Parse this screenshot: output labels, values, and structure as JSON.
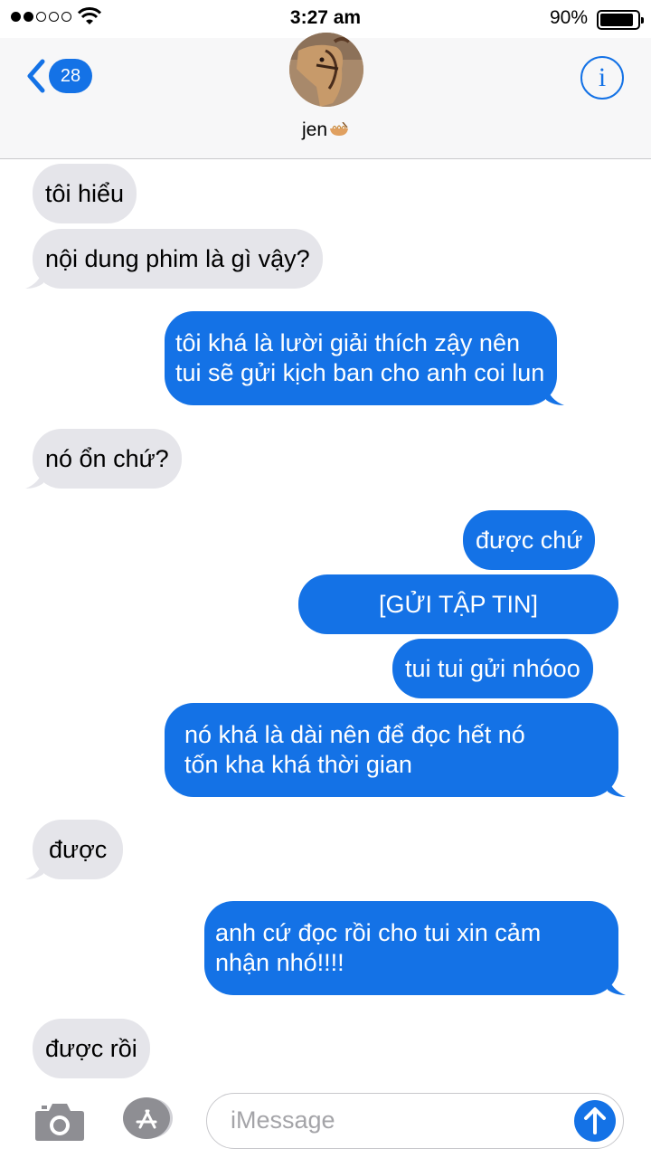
{
  "status_bar": {
    "time": "3:27 am",
    "battery": "90%",
    "battery_level": 0.9,
    "signal_bars": 2
  },
  "header": {
    "back_count": "28",
    "contact_name": "jen",
    "info_icon": "i"
  },
  "messages": [
    {
      "type": "received",
      "text": "tôi hiểu"
    },
    {
      "type": "received",
      "text": "nội dung phim là gì vậy?"
    },
    {
      "type": "sent",
      "lines": [
        "tôi khá là lười giải thích zậy nên",
        "tui sẽ gửi kịch ban cho anh coi lun"
      ]
    },
    {
      "type": "received",
      "text": "nó ổn chứ?"
    },
    {
      "type": "sent",
      "text": "được chứ"
    },
    {
      "type": "sent",
      "text": "[GỬI TẬP TIN]"
    },
    {
      "type": "sent",
      "text": "tui tui gửi nhóoo"
    },
    {
      "type": "sent",
      "lines": [
        "nó khá là dài nên để đọc hết nó",
        "tốn kha khá thời gian"
      ]
    },
    {
      "type": "received",
      "text": "được"
    },
    {
      "type": "sent",
      "lines": [
        "anh cứ đọc rồi cho tui xin cảm",
        "nhận nhó!!!!"
      ]
    },
    {
      "type": "received",
      "text": "được rồi"
    }
  ],
  "input": {
    "placeholder": "iMessage"
  },
  "colors": {
    "accent": "#1472e6",
    "received_bubble": "#e5e5ea",
    "header_bg": "#f7f7f8"
  },
  "icons": [
    "wifi-icon",
    "battery-icon",
    "back-chevron-icon",
    "info-icon",
    "camera-icon",
    "app-store-icon",
    "send-arrow-icon"
  ]
}
